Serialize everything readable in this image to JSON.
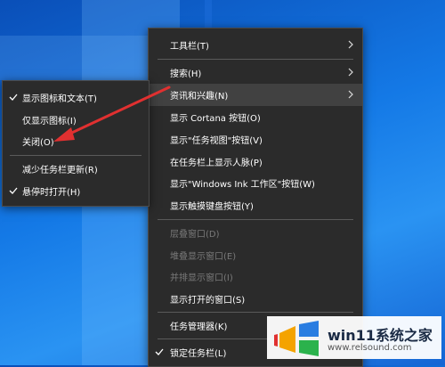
{
  "taskbar_menu": {
    "items": [
      {
        "label": "工具栏(T)",
        "arrow": true,
        "disabled": false
      },
      {
        "label": "搜索(H)",
        "arrow": true,
        "disabled": false
      },
      {
        "label": "资讯和兴趣(N)",
        "arrow": true,
        "disabled": false,
        "highlighted": true
      },
      {
        "label": "显示 Cortana 按钮(O)",
        "disabled": false
      },
      {
        "label": "显示\"任务视图\"按钮(V)",
        "disabled": false
      },
      {
        "label": "在任务栏上显示人脉(P)",
        "disabled": false
      },
      {
        "label": "显示\"Windows Ink 工作区\"按钮(W)",
        "disabled": false
      },
      {
        "label": "显示触摸键盘按钮(Y)",
        "disabled": false
      },
      {
        "label": "层叠窗口(D)",
        "disabled": true
      },
      {
        "label": "堆叠显示窗口(E)",
        "disabled": true
      },
      {
        "label": "并排显示窗口(I)",
        "disabled": true
      },
      {
        "label": "显示打开的窗口(S)",
        "disabled": false
      },
      {
        "label": "任务管理器(K)",
        "disabled": false
      },
      {
        "label": "锁定任务栏(L)",
        "checked": true,
        "disabled": false
      }
    ]
  },
  "news_submenu": {
    "items": [
      {
        "label": "显示图标和文本(T)",
        "checked": true
      },
      {
        "label": "仅显示图标(I)",
        "checked": false
      },
      {
        "label": "关闭(O)",
        "checked": false
      },
      {
        "label": "减少任务栏更新(R)",
        "checked": false
      },
      {
        "label": "悬停时打开(H)",
        "checked": true
      }
    ]
  },
  "watermark": {
    "title": "win11系统之家",
    "url": "www.relsound.com"
  },
  "colors": {
    "menu_bg": "#2b2b2b",
    "menu_highlight": "#414141",
    "annotation_arrow": "#e03030"
  }
}
